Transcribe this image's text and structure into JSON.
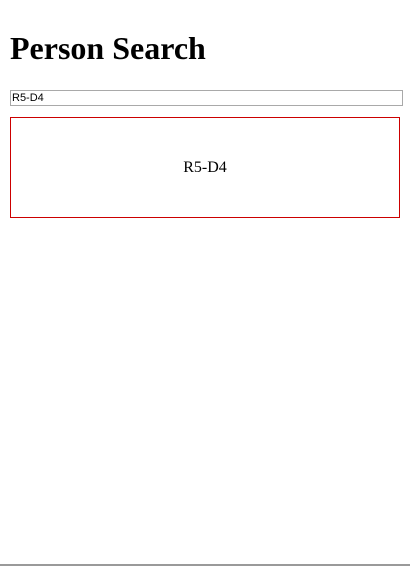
{
  "page": {
    "title": "Person Search"
  },
  "search": {
    "value": "R5-D4"
  },
  "results": [
    {
      "name": "R5-D4"
    }
  ],
  "colors": {
    "result_border": "#cc0000",
    "input_border": "#a9a9a9"
  }
}
